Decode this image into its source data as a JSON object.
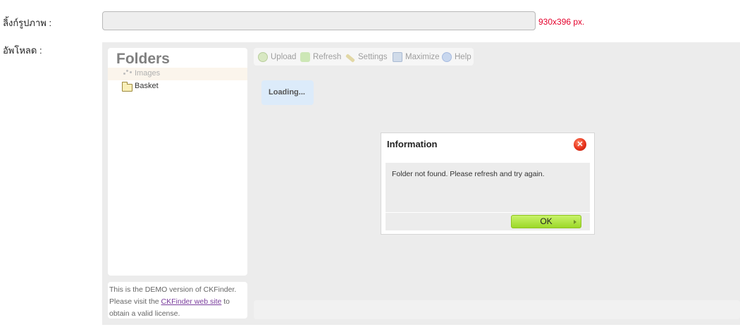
{
  "form": {
    "link_label": "ลิ้งก์รูปภาพ :",
    "url_value": "",
    "size_note": "930x396 px.",
    "upload_label": "อัพโหลด :"
  },
  "finder": {
    "folders_title": "Folders",
    "folders": [
      {
        "name": "Images",
        "state": "loading"
      },
      {
        "name": "Basket",
        "state": "closed"
      }
    ],
    "toolbar": {
      "upload": "Upload",
      "refresh": "Refresh",
      "settings": "Settings",
      "maximize": "Maximize",
      "help": "Help"
    },
    "loading_text": "Loading...",
    "demo": {
      "line1": "This is the DEMO version of CKFinder.",
      "line2_pre": "Please visit the ",
      "link_text": "CKFinder web site",
      "line2_post": " to",
      "line3": "obtain a valid license."
    }
  },
  "dialog": {
    "title": "Information",
    "message": "Folder not found. Please refresh and try again.",
    "ok_label": "OK"
  },
  "colors": {
    "size_note": "#e4002b",
    "ok_button": "#9cd829",
    "close_button": "#e8321b"
  },
  "icons": [
    "spinner-icon",
    "folder-icon",
    "upload-icon",
    "refresh-icon",
    "settings-icon",
    "maximize-icon",
    "help-icon",
    "close-icon",
    "arrow-right-icon"
  ]
}
